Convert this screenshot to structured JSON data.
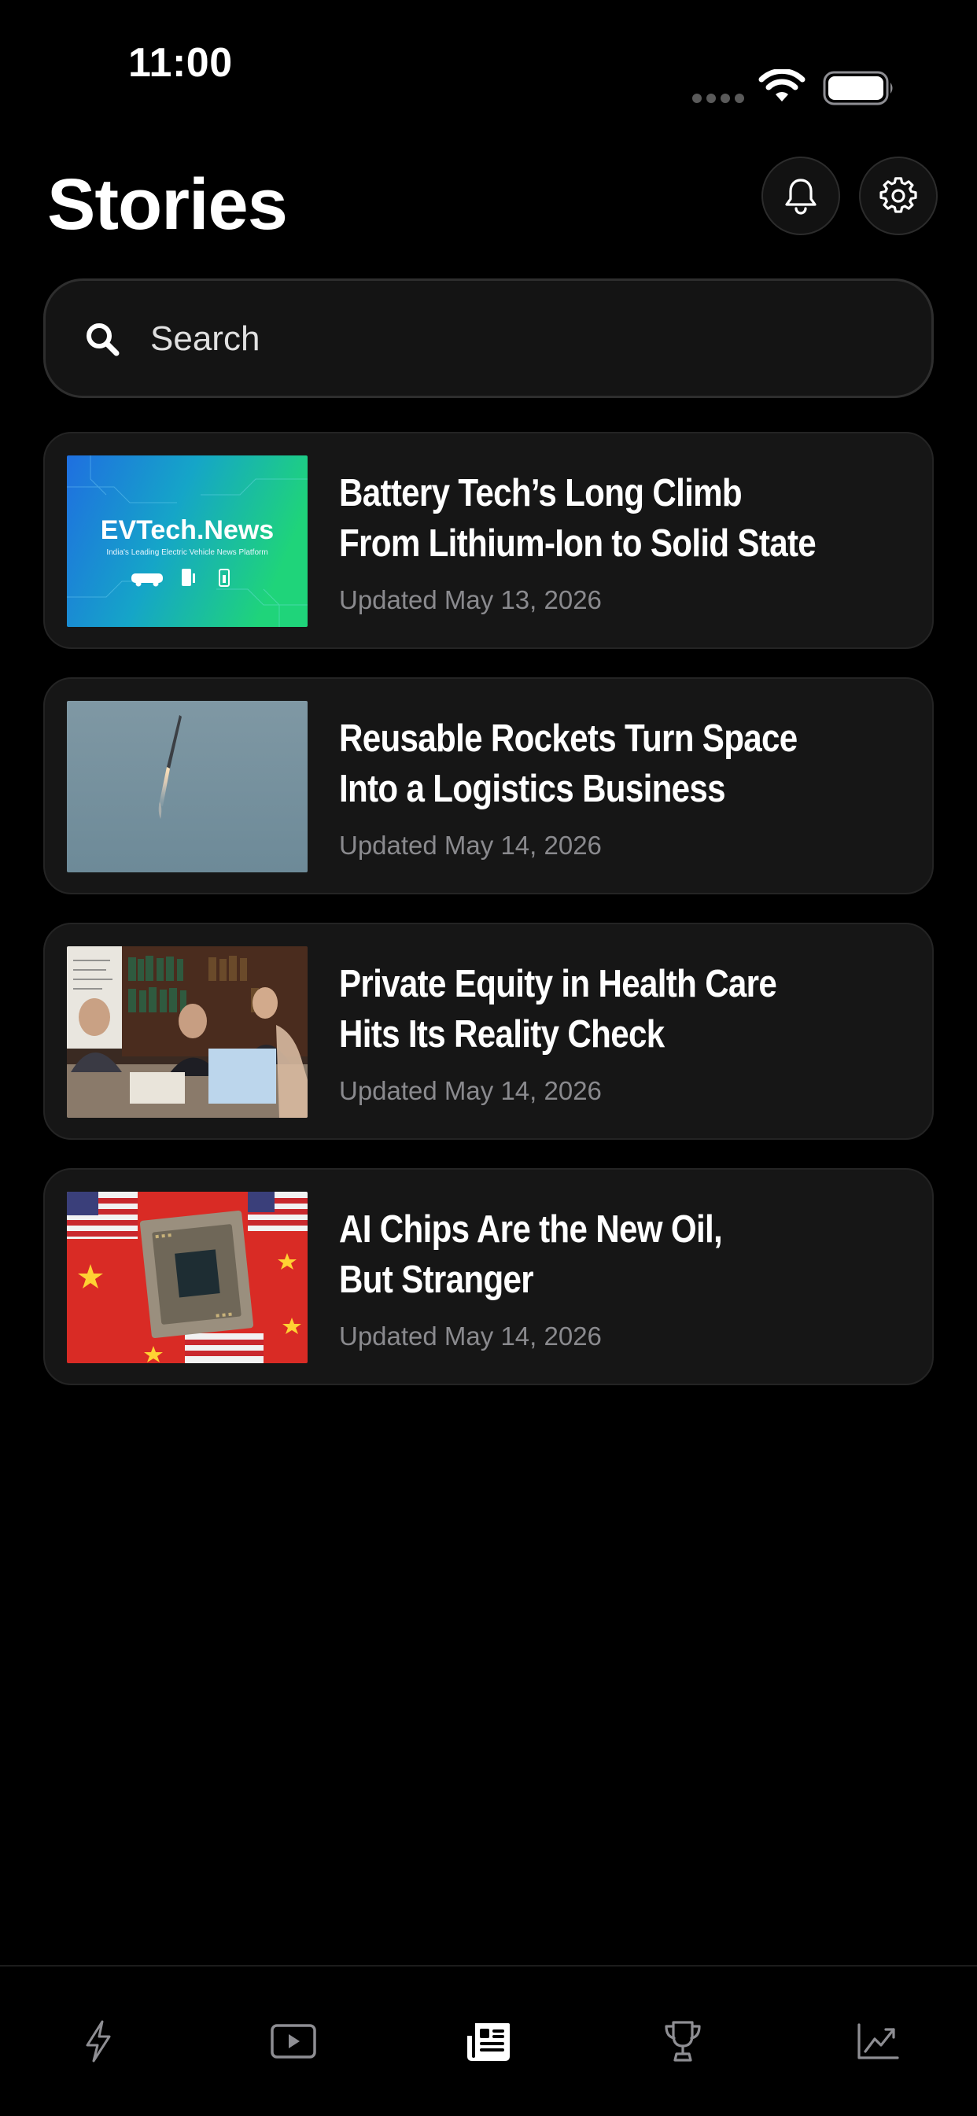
{
  "status_bar": {
    "time": "11:00"
  },
  "header": {
    "title": "Stories",
    "bell_icon": "bell-icon",
    "gear_icon": "gear-icon"
  },
  "search": {
    "placeholder": "Search",
    "icon": "search-icon"
  },
  "stories": [
    {
      "title": "Battery Tech’s Long Climb\nFrom Lithium-Ion to Solid State",
      "date": "Updated May 13, 2026",
      "thumb_brand": "EVTech.News",
      "thumb_tagline": "India's Leading Electric Vehicle News Platform"
    },
    {
      "title": "Reusable Rockets Turn Space\nInto a Logistics Business",
      "date": "Updated May 14, 2026"
    },
    {
      "title": "Private Equity in Health Care\nHits Its Reality Check",
      "date": "Updated May 14, 2026"
    },
    {
      "title": "AI Chips Are the New Oil,\nBut Stranger",
      "date": "Updated May 14, 2026"
    }
  ],
  "tab_bar": {
    "items": [
      {
        "icon": "lightning-icon",
        "active": false
      },
      {
        "icon": "video-icon",
        "active": false
      },
      {
        "icon": "stories-icon",
        "active": true
      },
      {
        "icon": "trophy-icon",
        "active": false
      },
      {
        "icon": "markets-chart-icon",
        "active": false
      }
    ]
  },
  "colors": {
    "background": "#000000",
    "card": "#161616",
    "secondary_text": "#8a8a8e",
    "inactive_icon": "#8e8e93"
  }
}
